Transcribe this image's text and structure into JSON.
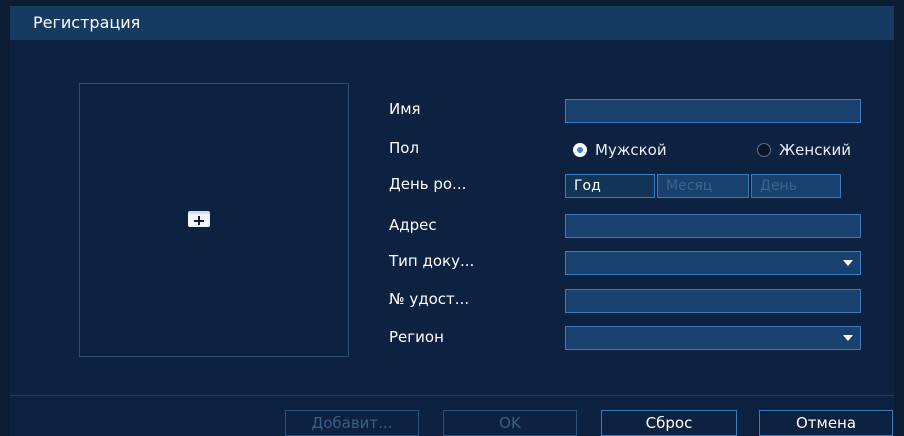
{
  "dialog": {
    "title": "Регистрация"
  },
  "form": {
    "name_label": "Имя",
    "gender_label": "Пол",
    "gender_options": [
      "Мужской",
      "Женский"
    ],
    "gender_selected": "Мужской",
    "birthday_label": "День ро...",
    "birthday_parts": [
      "Год",
      "Месяц",
      "День"
    ],
    "address_label": "Адрес",
    "doc_type_label": "Тип доку...",
    "doc_number_label": "№ удост...",
    "region_label": "Регион"
  },
  "buttons": {
    "add": "Добавит...",
    "ok": "OK",
    "reset": "Сброс",
    "cancel": "Отмена"
  },
  "icons": {
    "add_photo": "add-photo-icon",
    "select_arrow": "chevron-down-icon"
  },
  "colors": {
    "titlebar": "#163a61",
    "background": "#0d2240",
    "accent": "#3b7cc0",
    "radio_selected": "#2f8ae0"
  }
}
